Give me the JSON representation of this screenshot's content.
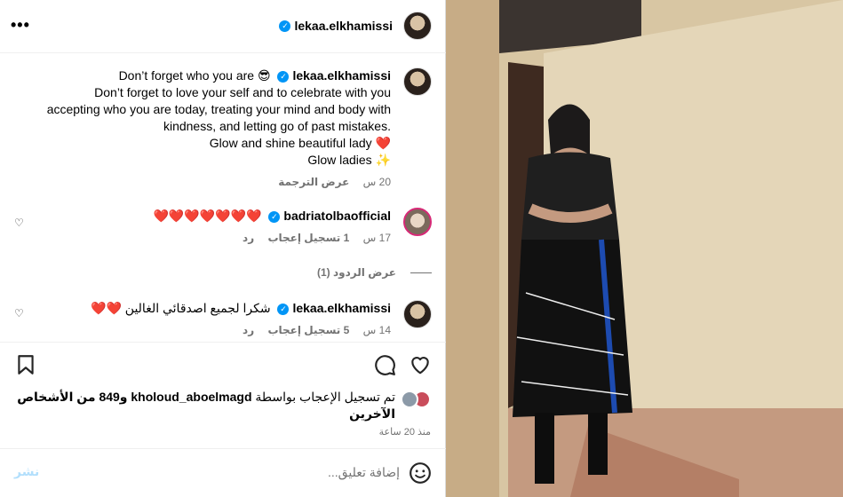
{
  "header": {
    "username": "lekaa.elkhamissi"
  },
  "caption": {
    "username": "lekaa.elkhamissi",
    "first_line": "Don’t forget who you are 😎",
    "lines": [
      "Don’t forget to love your self and to celebrate with you",
      "accepting who you are today, treating your mind and body with",
      "kindness, and letting go of past mistakes.",
      "Glow and shine beautiful lady ❤️",
      "Glow ladies ✨"
    ],
    "time": "20 س",
    "translate": "عرض الترجمة"
  },
  "comments": [
    {
      "username": "badriatolbaofficial",
      "text": "❤️❤️❤️❤️❤️❤️❤️",
      "time": "17 س",
      "likes": "1 تسجيل إعجاب",
      "reply": "رد"
    },
    {
      "username": "lekaa.elkhamissi",
      "text": "شكرا لجميع اصدقائي الغالين ❤️❤️",
      "time": "14 س",
      "likes": "5 تسجيل إعجاب",
      "reply": "رد"
    }
  ],
  "view_replies": "عرض الردود (1)",
  "likes": {
    "prefix": "تم تسجيل الإعجاب بواسطة ",
    "user": "kholoud_aboelmagd",
    "suffix": " و849 من الأشخاص الآخرين"
  },
  "time_ago": "منذ 20 ساعة",
  "composer": {
    "placeholder": "إضافة تعليق...",
    "post_label": "نشر"
  },
  "icons": {
    "more": "more-icon",
    "verified": "verified-badge-icon",
    "heart": "heart-icon",
    "comment": "comment-icon",
    "bookmark": "bookmark-icon",
    "emoji": "emoji-icon"
  }
}
